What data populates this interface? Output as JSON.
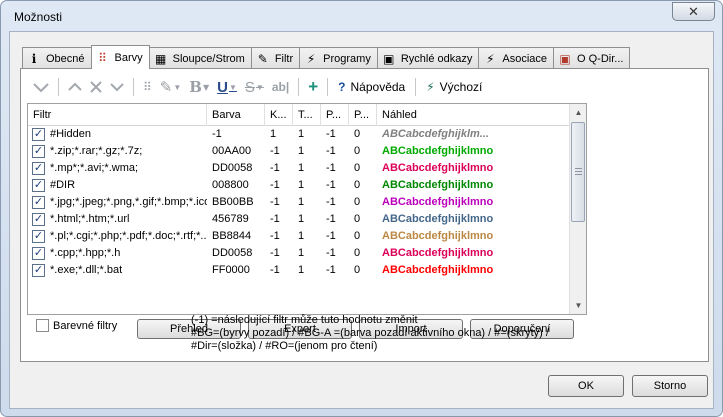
{
  "window": {
    "title": "Možnosti",
    "close_label": "✕"
  },
  "tabs": [
    {
      "label": "Obecné",
      "icon": "info-icon",
      "glyph": "i",
      "active": false
    },
    {
      "label": "Barvy",
      "icon": "palette-icon",
      "glyph": "⠿",
      "active": true
    },
    {
      "label": "Sloupce/Strom",
      "icon": "columns-icon",
      "glyph": "▦",
      "active": false
    },
    {
      "label": "Filtr",
      "icon": "filter-pen-icon",
      "glyph": "✎",
      "active": false
    },
    {
      "label": "Programy",
      "icon": "programs-icon",
      "glyph": "⚡",
      "active": false
    },
    {
      "label": "Rychlé odkazy",
      "icon": "shortcuts-icon",
      "glyph": "▣",
      "active": false
    },
    {
      "label": "Asociace",
      "icon": "association-icon",
      "glyph": "⚡",
      "active": false
    },
    {
      "label": "O Q-Dir...",
      "icon": "about-icon",
      "glyph": "▣",
      "active": false
    }
  ],
  "toolbar": {
    "help_label": "Nápověda",
    "default_label": "Výchozí",
    "add_symbol": "+",
    "help_symbol": "?",
    "default_symbol": "⚡"
  },
  "grid": {
    "columns": [
      "Filtr",
      "Barva",
      "K...",
      "T...",
      "P...",
      "P...",
      "Náhled"
    ],
    "rows": [
      {
        "filter": "#Hidden",
        "color": "-1",
        "k": "1",
        "t": "1",
        "p1": "-1",
        "p2": "0",
        "preview": "ABCabcdefghijklm...",
        "preview_color": "#808080",
        "italic": true
      },
      {
        "filter": "*.zip;*.rar;*.gz;*.7z;",
        "color": "00AA00",
        "k": "-1",
        "t": "1",
        "p1": "-1",
        "p2": "0",
        "preview": "ABCabcdefghijklmno",
        "preview_color": "#00AA00",
        "italic": false
      },
      {
        "filter": "*.mp*;*.avi;*.wma;",
        "color": "DD0058",
        "k": "-1",
        "t": "1",
        "p1": "-1",
        "p2": "0",
        "preview": "ABCabcdefghijklmno",
        "preview_color": "#DD0058",
        "italic": false
      },
      {
        "filter": "#DIR",
        "color": "008800",
        "k": "-1",
        "t": "1",
        "p1": "-1",
        "p2": "0",
        "preview": "ABCabcdefghijklmno",
        "preview_color": "#008800",
        "italic": false
      },
      {
        "filter": "*.jpg;*.jpeg;*.png,*.gif;*.bmp;*.ico",
        "color": "BB00BB",
        "k": "-1",
        "t": "1",
        "p1": "-1",
        "p2": "0",
        "preview": "ABCabcdefghijklmno",
        "preview_color": "#BB00BB",
        "italic": false
      },
      {
        "filter": "*.html;*.htm;*.url",
        "color": "456789",
        "k": "-1",
        "t": "1",
        "p1": "-1",
        "p2": "0",
        "preview": "ABCabcdefghijklmno",
        "preview_color": "#456789",
        "italic": false
      },
      {
        "filter": "*.pl;*.cgi;*.php;*.pdf;*.doc;*.rtf;*...",
        "color": "BB8844",
        "k": "-1",
        "t": "1",
        "p1": "-1",
        "p2": "0",
        "preview": "ABCabcdefghijklmno",
        "preview_color": "#BB8844",
        "italic": false
      },
      {
        "filter": "*.cpp;*.hpp;*.h",
        "color": "DD0058",
        "k": "-1",
        "t": "1",
        "p1": "-1",
        "p2": "0",
        "preview": "ABCabcdefghijklmno",
        "preview_color": "#DD0058",
        "italic": false
      },
      {
        "filter": "*.exe;*.dll;*.bat",
        "color": "FF0000",
        "k": "-1",
        "t": "1",
        "p1": "-1",
        "p2": "0",
        "preview": "ABCabcdefghijklmno",
        "preview_color": "#FF0000",
        "italic": false
      }
    ]
  },
  "panel_buttons": {
    "overview": "Přehled",
    "export": "Export",
    "import": "Import",
    "recommendation": "Doporučení"
  },
  "color_filters_label": "Barevné filtry",
  "hint_lines": [
    "(-1) =následující filtr může tuto hodnotu změnit",
    "#BG=(byrvy pozadí) / #BG-A =(barva pozadí aktivního okna) / #=(skrytý) /",
    "#Dir=(složka) / #RO=(jenom pro čtení)"
  ],
  "footer": {
    "ok_label": "OK",
    "cancel_label": "Storno"
  }
}
